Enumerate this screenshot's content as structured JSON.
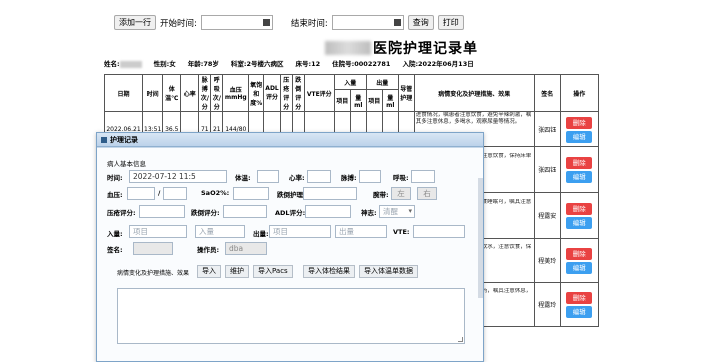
{
  "toolbar": {
    "add_row": "添加一行",
    "start_label": "开始时间:",
    "end_label": "结束时间:",
    "query": "查询",
    "print": "打印"
  },
  "title": "医院护理记录单",
  "patient": {
    "name_label": "姓名:",
    "gender": "性别:女",
    "age": "年龄:78岁",
    "ward": "科室:2号楼六病区",
    "bed": "床号:12",
    "admission_no": "住院号:00022781",
    "admit_date": "入院:2022年06月13日"
  },
  "table": {
    "headers": [
      "日期",
      "时间",
      "体温℃",
      "心率",
      "脉搏次/分",
      "呼吸次/分",
      "血压mmHg",
      "氧饱和度%",
      "ADL评分",
      "压疮评分",
      "跌倒评分",
      "VTE评分",
      "入量",
      "出量",
      "导管护理",
      "病情变化及护理措施、效果",
      "签名",
      "操作"
    ],
    "sub_headers": {
      "in_name": "项目",
      "in_ml": "量ml",
      "out_name": "项目",
      "out_ml": "量ml"
    },
    "first_row": {
      "date": "2022.06.21",
      "time": "13:51",
      "temp": "36.5",
      "pulse": "71",
      "resp": "21",
      "bp": "144/80"
    },
    "signatures": [
      "张四钰",
      "张四钰",
      "程露安",
      "程美玲",
      "程露玲"
    ],
    "delete_label": "删除",
    "edit_label": "编辑",
    "observations": [
      "进食情况，嘱患者注意饮食，避免辛辣刺激，嘱其多注意休息，多喝水，观察尿量等情况。",
      "患者生命体征平稳，嘱患者注意饮食，保持床单位清洁，防止跌倒坠床。",
      "患者病情稳定，精神可，饮食睡眠可，嘱其注意休息，防止跌倒。",
      "患者神清，饮食可，嘱其多饮水，注意饮食，保持心情舒畅。",
      "嘱患者注意饮食，遵医嘱用药，嘱其注意休息，防止跌倒。"
    ]
  },
  "modal": {
    "title": "护理记录",
    "basic_info": "病人基本信息",
    "time_label": "时间:",
    "time_value": "2022-07-12 11:5",
    "temp_label": "体温:",
    "hr_label": "心率:",
    "pulse_label": "脉搏:",
    "resp_label": "呼吸:",
    "bp_label": "血压:",
    "bp_sep": "/",
    "spo2_label": "SaO2%:",
    "fall_label": "跌倒护理:",
    "bed_label": "腕带:",
    "left": "左",
    "right": "右",
    "pressure_label": "压疮评分:",
    "fall_score_label": "跌倒评分:",
    "adl_label": "ADL评分:",
    "mental_label": "神志:",
    "mental_value": "清醒",
    "in_label": "入量:",
    "in_item": "项目",
    "in_amount": "入量",
    "out_label": "出量:",
    "out_item": "项目",
    "out_amount": "出量",
    "vte_label": "VTE:",
    "sign_label": "签名:",
    "operator_label": "操作员:",
    "operator_value": "dba",
    "obs_label": "病情变化及护理措施、效果",
    "btn_import": "导入",
    "btn_maintain": "维护",
    "btn_import_pacs": "导入Pacs",
    "btn_import_exam": "导入体检结果",
    "btn_import_temp": "导入体温单数据"
  }
}
